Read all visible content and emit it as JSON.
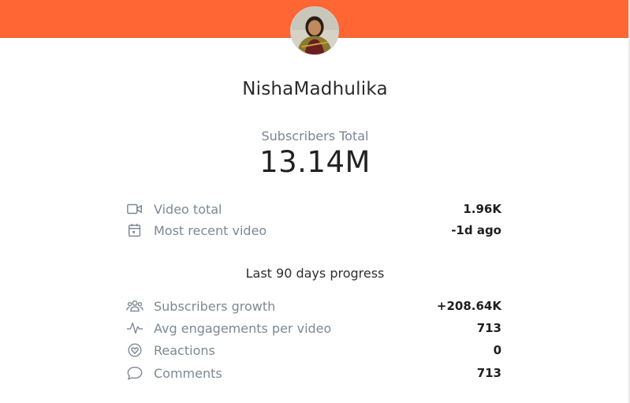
{
  "channel": {
    "name": "NishaMadhulika"
  },
  "subscribers": {
    "label": "Subscribers Total",
    "value": "13.14M"
  },
  "stats": [
    {
      "icon": "video-camera-icon",
      "label": "Video total",
      "value": "1.96K"
    },
    {
      "icon": "calendar-icon",
      "label": "Most recent video",
      "value": "-1d ago"
    }
  ],
  "progress": {
    "heading": "Last 90 days progress",
    "items": [
      {
        "icon": "users-icon",
        "label": "Subscribers growth",
        "value": "+208.64K"
      },
      {
        "icon": "activity-icon",
        "label": "Avg engagements per video",
        "value": "713"
      },
      {
        "icon": "heart-icon",
        "label": "Reactions",
        "value": "0"
      },
      {
        "icon": "comment-icon",
        "label": "Comments",
        "value": "713"
      }
    ]
  },
  "colors": {
    "header": "#ff6633",
    "muted_text": "#7e8894",
    "strong_text": "#1f1f1f"
  }
}
